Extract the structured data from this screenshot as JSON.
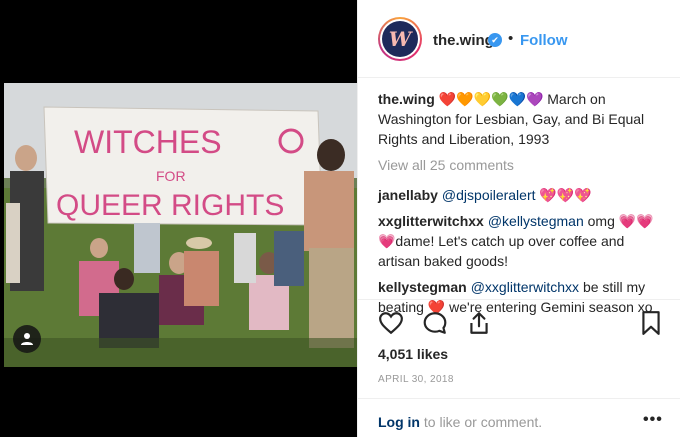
{
  "post": {
    "username": "the.wing",
    "verified_mark": "✔",
    "separator": "•",
    "follow_label": "Follow",
    "avatar_letter": "W"
  },
  "photo": {
    "banner_line1": "WITCHES",
    "banner_for": "FOR",
    "banner_line2": "QUEER RIGHTS",
    "banner_text_color": "#d34b86"
  },
  "caption": {
    "author": "the.wing",
    "emoji": "❤️🧡💛💚💙💜",
    "text": "March on Washington for Lesbian, Gay, and Bi Equal Rights and Liberation, 1993"
  },
  "view_all": "View all 25 comments",
  "comments": [
    {
      "author": "janellaby",
      "mention": "@djspoileralert",
      "text": " 💖💖💖"
    },
    {
      "author": "xxglitterwitchxx",
      "mention": "@kellystegman",
      "text": " omg 💗💗💗dame! Let's catch up over coffee and artisan baked goods!"
    },
    {
      "author": "kellystegman",
      "mention": "@xxglitterwitchxx",
      "text": " be still my beating ❤️ we're entering Gemini season xo"
    }
  ],
  "likes": "4,051 likes",
  "date": "APRIL 30, 2018",
  "footer": {
    "login_label": "Log in",
    "login_suffix": " to like or comment.",
    "more_label": "•••"
  },
  "icons": [
    "heart-icon",
    "comment-icon",
    "share-icon",
    "bookmark-icon",
    "user-tag-icon",
    "more-options-icon"
  ],
  "colors": {
    "accent": "#3897f0",
    "link": "#003569",
    "muted": "#999999"
  }
}
